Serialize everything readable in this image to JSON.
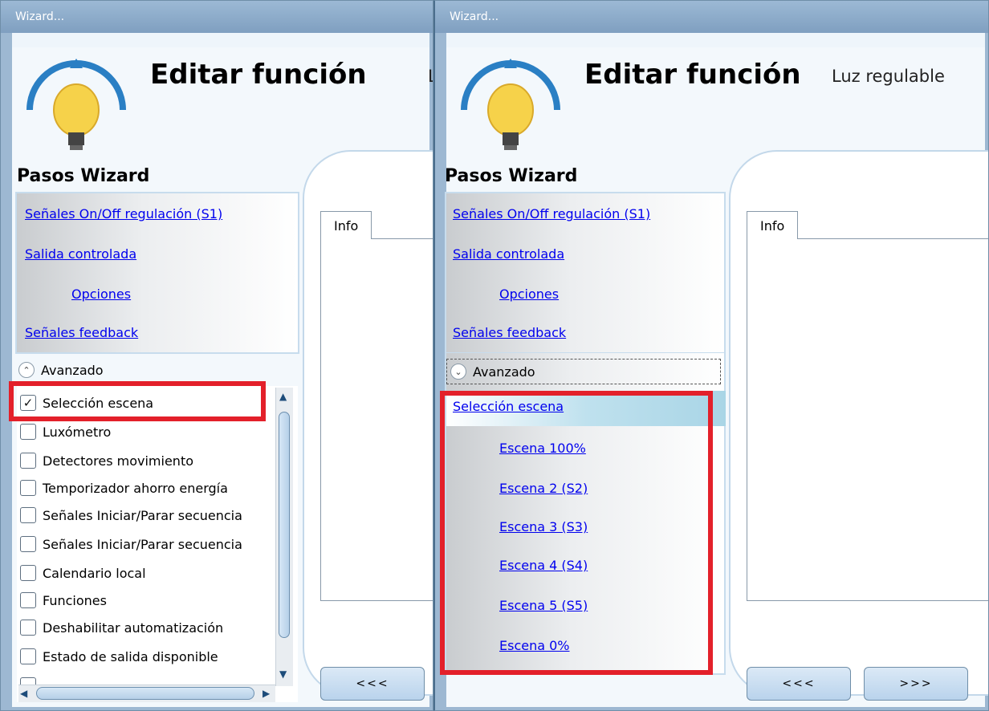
{
  "left": {
    "window_title": "Wizard...",
    "edit_title": "Editar función",
    "function_type": "Lu",
    "steps_title": "Pasos Wizard",
    "steps": [
      {
        "label": "Señales On/Off regulación (S1)"
      },
      {
        "label": "Salida controlada"
      },
      {
        "label": "Opciones"
      },
      {
        "label": "Señales feedback"
      }
    ],
    "advanced_label": "Avanzado",
    "checkboxes": [
      {
        "label": "Selección escena",
        "checked": true
      },
      {
        "label": "Luxómetro",
        "checked": false
      },
      {
        "label": "Detectores movimiento",
        "checked": false
      },
      {
        "label": "Temporizador ahorro energía",
        "checked": false
      },
      {
        "label": "Señales Iniciar/Parar secuencia",
        "checked": false
      },
      {
        "label": "Señales Iniciar/Parar secuencia",
        "checked": false
      },
      {
        "label": "Calendario local",
        "checked": false
      },
      {
        "label": "Funciones",
        "checked": false
      },
      {
        "label": "Deshabilitar automatización",
        "checked": false
      },
      {
        "label": "Estado de salida disponible",
        "checked": false
      }
    ],
    "tab_label": "Info",
    "back_button": "<<<"
  },
  "right": {
    "window_title": "Wizard...",
    "edit_title": "Editar función",
    "function_type": "Luz regulable",
    "steps_title": "Pasos Wizard",
    "steps": [
      {
        "label": "Señales On/Off regulación (S1)"
      },
      {
        "label": "Salida controlada"
      },
      {
        "label": "Opciones"
      },
      {
        "label": "Señales feedback"
      }
    ],
    "advanced_label": "Avanzado",
    "scene_selection": "Selección escena",
    "scenes": [
      {
        "label": "Escena 100%"
      },
      {
        "label": "Escena 2 (S2)"
      },
      {
        "label": "Escena 3 (S3)"
      },
      {
        "label": "Escena 4 (S4)"
      },
      {
        "label": "Escena 5 (S5)"
      },
      {
        "label": "Escena 0%"
      }
    ],
    "tab_label": "Info",
    "back_button": "<<<",
    "next_button": ">>>"
  },
  "colors": {
    "highlight_red": "#e3202a",
    "link_blue": "#0000ee",
    "titlebar": "#8fadcb"
  },
  "icons": [
    "lightbulb-dimmer-icon",
    "chevron-up-icon",
    "chevron-down-icon",
    "checkmark-icon"
  ]
}
